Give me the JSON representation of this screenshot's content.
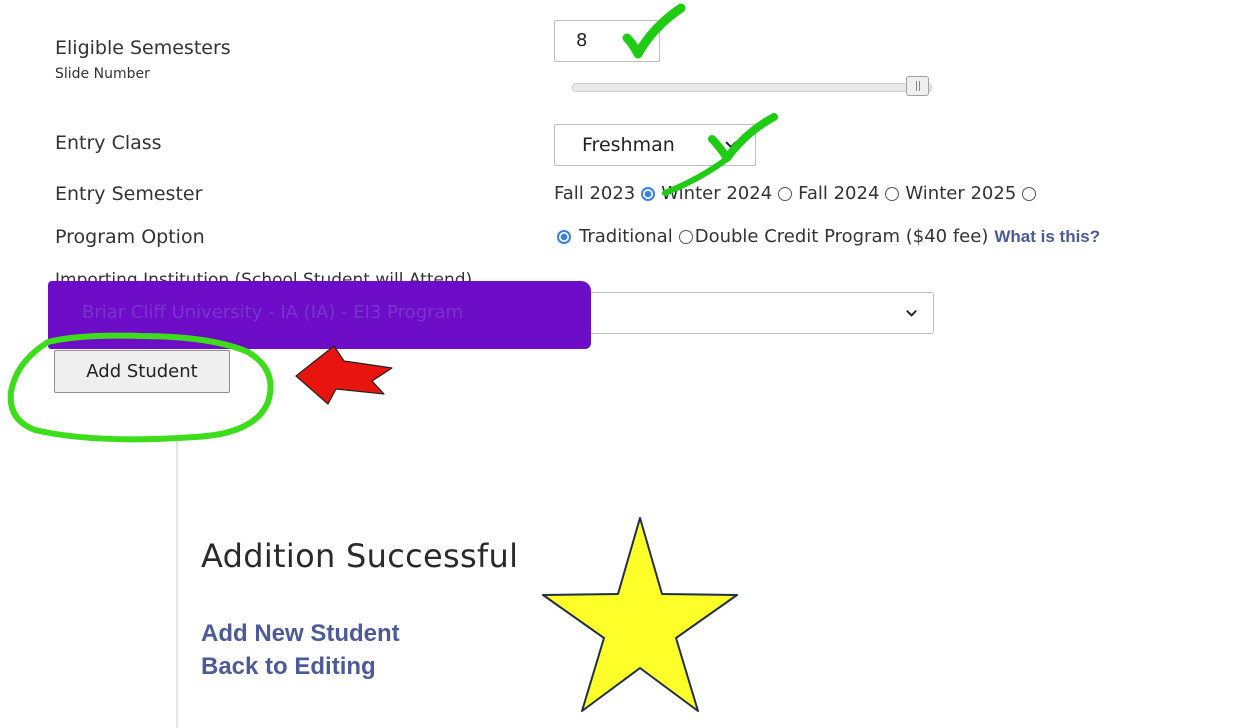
{
  "form": {
    "eligible_semesters": {
      "label": "Eligible Semesters",
      "sublabel": "Slide Number",
      "value": "8",
      "slider_fraction": 1.0
    },
    "entry_class": {
      "label": "Entry Class",
      "selected": "Freshman"
    },
    "entry_semester": {
      "label": "Entry Semester",
      "options": [
        {
          "label": "Fall 2023",
          "checked": true
        },
        {
          "label": "Winter 2024",
          "checked": false
        },
        {
          "label": "Fall 2024",
          "checked": false
        },
        {
          "label": "Winter 2025",
          "checked": false
        }
      ]
    },
    "program_option": {
      "label": "Program Option",
      "options": [
        {
          "label": "Traditional",
          "checked": true
        },
        {
          "label": "Double Credit Program ($40 fee)",
          "checked": false
        }
      ],
      "help_link": "What is this?"
    },
    "importing_institution": {
      "label": "Importing Institution (School Student will Attend)",
      "selected": "Briar Cliff University - IA (IA) - EI3 Program"
    },
    "submit_label": "Add Student"
  },
  "result": {
    "title": "Addition Successful",
    "links": [
      "Add New Student",
      "Back to Editing"
    ]
  },
  "annotations": {
    "check_color": "#1fcc14",
    "circle_color": "#3ddd1c",
    "arrow_color": "#e8140f",
    "star_color": "#ffff2a",
    "redaction_color": "#6a08c7"
  }
}
